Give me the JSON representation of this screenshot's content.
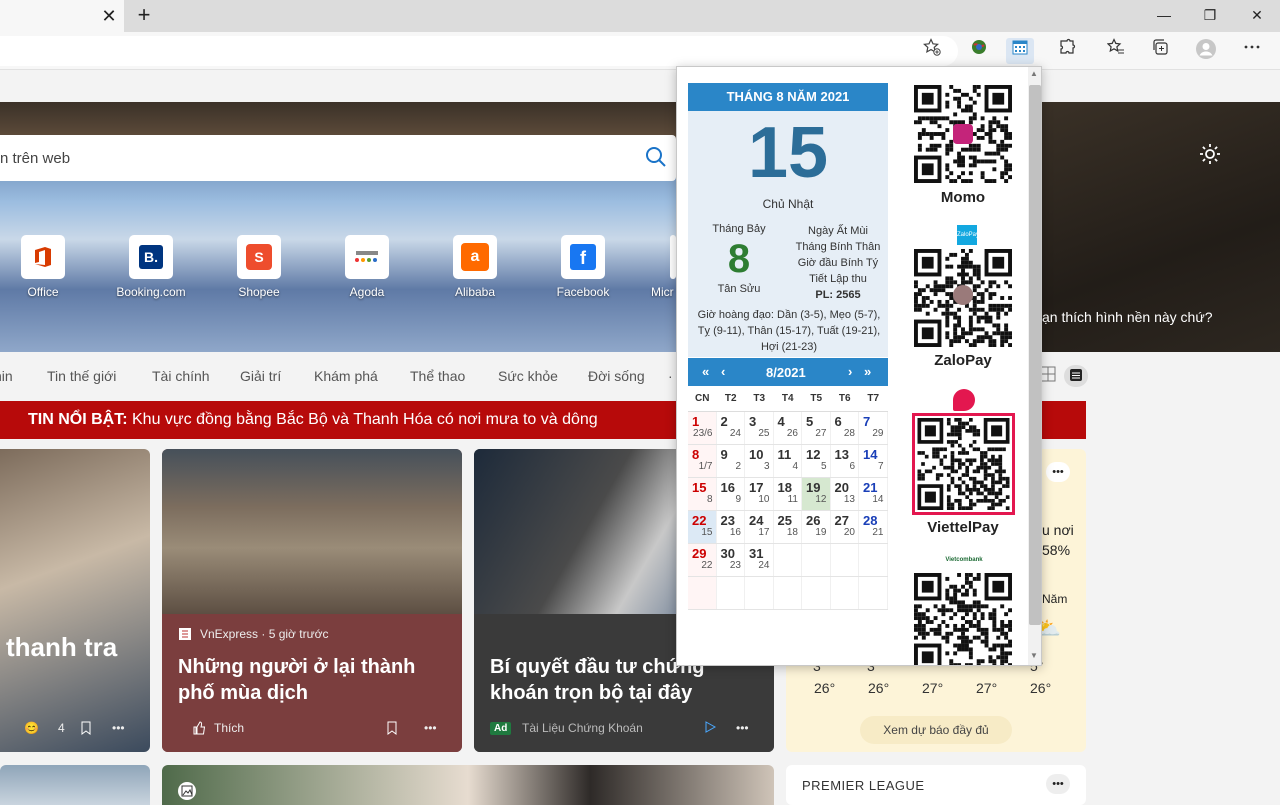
{
  "browser": {
    "tab_close": "✕",
    "new_tab": "+",
    "win_min": "—",
    "win_restore": "❐",
    "win_close": "✕"
  },
  "newtab_page": {
    "search_text": "n trên web",
    "bg_message": "ạn thích hình nền này chứ?",
    "quick_links": [
      {
        "label": "Office",
        "icon": "office-icon",
        "color": "#d83b01"
      },
      {
        "label": "Booking.com",
        "icon": "booking-icon",
        "color": "#003580"
      },
      {
        "label": "Shopee",
        "icon": "shopee-icon",
        "color": "#ee4d2d"
      },
      {
        "label": "Agoda",
        "icon": "agoda-icon",
        "color": "#5a9e2f"
      },
      {
        "label": "Alibaba",
        "icon": "alibaba-icon",
        "color": "#ff6a00"
      },
      {
        "label": "Facebook",
        "icon": "facebook-icon",
        "color": "#1877f2"
      },
      {
        "label": "Micr",
        "icon": "microsoft-icon",
        "color": "#737373"
      }
    ],
    "categories": [
      "hin",
      "Tin thế giới",
      "Tài chính",
      "Giải trí",
      "Khám phá",
      "Thể thao",
      "Sức khỏe",
      "Đời sống",
      "·"
    ],
    "breaking": {
      "label": "TIN NỔI BẬT:",
      "text": "Khu vực đồng bằng Bắc Bộ và Thanh Hóa có nơi mưa to và dông"
    },
    "cards": [
      {
        "title": "thanh tra",
        "reactions": "4"
      },
      {
        "source": "VnExpress · 5 giờ trước",
        "title": "Những người ở lại thành phố mùa dịch",
        "like": "Thích"
      },
      {
        "title": "Bí quyết đầu tư chứng khoán trọn bộ tại đây",
        "ad": "Ad",
        "advertiser": "Tài Liệu Chứng Khoán"
      }
    ],
    "weather": {
      "frag1": "u nơi",
      "frag2": "58%",
      "frag3": "Năm",
      "highs": [
        "3 ",
        "3 ",
        "",
        "",
        "5°"
      ],
      "lows": [
        "26°",
        "26°",
        "27°",
        "27°",
        "26°"
      ],
      "forecast_button": "Xem dự báo đầy đủ"
    },
    "premier_league": "PREMIER LEAGUE"
  },
  "calendar": {
    "header": "THÁNG 8 NĂM 2021",
    "day": "15",
    "weekday": "Chủ Nhật",
    "lunar_month_label": "Tháng Bảy",
    "lunar_day": "8",
    "lunar_year": "Tân Sửu",
    "lunar_info": [
      "Ngày Ất Mùi",
      "Tháng Bính Thân",
      "Giờ đầu Bính Tý",
      "Tiết Lập thu",
      "PL: 2565"
    ],
    "gio_hoang_dao": "Giờ hoàng đạo: Dần (3-5), Mẹo (5-7), Tỵ (9-11), Thân (15-17), Tuất (19-21), Hợi (21-23)",
    "nav": {
      "prev_year": "«",
      "prev_month": "‹",
      "month": "8/2021",
      "next_month": "›",
      "next_year": "»"
    },
    "dow": [
      "CN",
      "T2",
      "T3",
      "T4",
      "T5",
      "T6",
      "T7"
    ],
    "weeks": [
      [
        [
          "1",
          "23/6"
        ],
        [
          "2",
          "24"
        ],
        [
          "3",
          "25"
        ],
        [
          "4",
          "26"
        ],
        [
          "5",
          "27"
        ],
        [
          "6",
          "28"
        ],
        [
          "7",
          "29"
        ]
      ],
      [
        [
          "8",
          "1/7"
        ],
        [
          "9",
          "2"
        ],
        [
          "10",
          "3"
        ],
        [
          "11",
          "4"
        ],
        [
          "12",
          "5"
        ],
        [
          "13",
          "6"
        ],
        [
          "14",
          "7"
        ]
      ],
      [
        [
          "15",
          "8"
        ],
        [
          "16",
          "9"
        ],
        [
          "17",
          "10"
        ],
        [
          "18",
          "11"
        ],
        [
          "19",
          "12"
        ],
        [
          "20",
          "13"
        ],
        [
          "21",
          "14"
        ]
      ],
      [
        [
          "22",
          "15"
        ],
        [
          "23",
          "16"
        ],
        [
          "24",
          "17"
        ],
        [
          "25",
          "18"
        ],
        [
          "26",
          "19"
        ],
        [
          "27",
          "20"
        ],
        [
          "28",
          "21"
        ]
      ],
      [
        [
          "29",
          "22"
        ],
        [
          "30",
          "23"
        ],
        [
          "31",
          "24"
        ],
        [
          "",
          ""
        ],
        [
          "",
          ""
        ],
        [
          "",
          ""
        ],
        [
          "",
          ""
        ]
      ],
      [
        [
          "",
          ""
        ],
        [
          "",
          ""
        ],
        [
          "",
          ""
        ],
        [
          "",
          ""
        ],
        [
          "",
          ""
        ],
        [
          "",
          ""
        ],
        [
          "",
          ""
        ]
      ]
    ],
    "payments": [
      {
        "label": "Momo"
      },
      {
        "label": "ZaloPay",
        "brand": "ZaloPay"
      },
      {
        "label": "ViettelPay"
      },
      {
        "label": "",
        "brand": "Vietcombank"
      }
    ]
  }
}
